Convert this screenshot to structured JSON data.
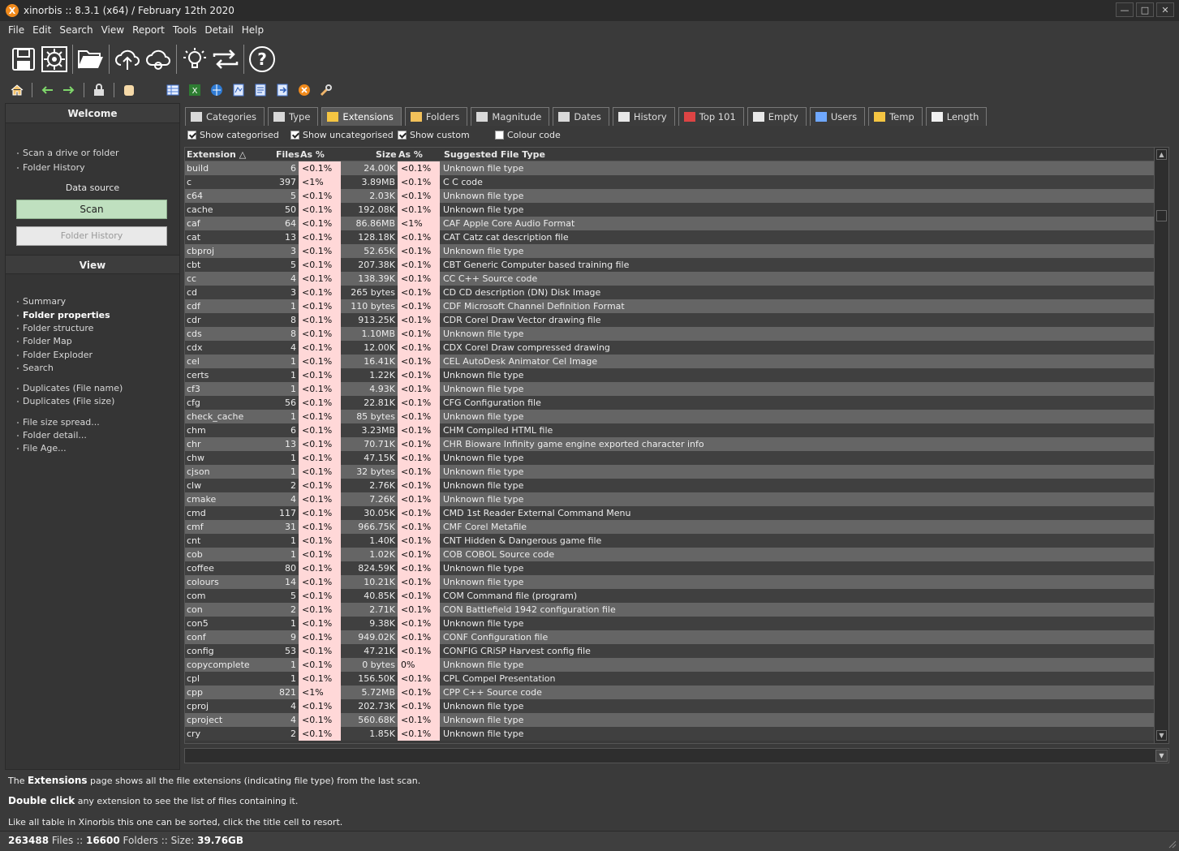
{
  "window": {
    "title": "xinorbis :: 8.3.1 (x64) / February 12th 2020",
    "logo_letter": "X"
  },
  "menu": [
    "File",
    "Edit",
    "Search",
    "View",
    "Report",
    "Tools",
    "Detail",
    "Help"
  ],
  "toolbar_big_icons": [
    "save-icon",
    "scan-settings-icon",
    "open-folder-icon",
    "cloud-upload-icon",
    "cloud-settings-icon",
    "idea-bulb-icon",
    "swap-arrows-icon",
    "help-icon"
  ],
  "toolbar_small_icons": [
    "home-icon",
    "back-arrow-icon",
    "forward-arrow-icon",
    "lock-icon",
    "database-icon",
    "table-icon",
    "excel-icon",
    "web-icon",
    "csv-icon",
    "doc-icon",
    "export-icon",
    "xinorbis-icon",
    "tools-icon"
  ],
  "sidebar": {
    "welcome_title": "Welcome",
    "welcome_links": [
      "Scan a drive or folder",
      "Folder History"
    ],
    "data_source_label": "Data source",
    "scan_button": "Scan",
    "folder_history_button": "Folder History",
    "view_title": "View",
    "view_links": [
      {
        "label": "Summary",
        "bold": false
      },
      {
        "label": "Folder properties",
        "bold": true
      },
      {
        "label": "Folder structure",
        "bold": false
      },
      {
        "label": "Folder Map",
        "bold": false
      },
      {
        "label": "Folder Exploder",
        "bold": false
      },
      {
        "label": "Search",
        "bold": false
      },
      {
        "label": "Duplicates (File name)",
        "bold": false
      },
      {
        "label": "Duplicates (File size)",
        "bold": false
      },
      {
        "label": "File size spread...",
        "bold": false
      },
      {
        "label": "Folder detail...",
        "bold": false
      },
      {
        "label": "File Age...",
        "bold": false
      }
    ]
  },
  "tabs": [
    {
      "label": "Categories",
      "icon": "categories-icon",
      "active": false
    },
    {
      "label": "Type",
      "icon": "type-icon",
      "active": false
    },
    {
      "label": "Extensions",
      "icon": "extensions-icon",
      "active": true
    },
    {
      "label": "Folders",
      "icon": "folder-icon",
      "active": false
    },
    {
      "label": "Magnitude",
      "icon": "magnitude-icon",
      "active": false
    },
    {
      "label": "Dates",
      "icon": "calendar-icon",
      "active": false
    },
    {
      "label": "History",
      "icon": "clock-icon",
      "active": false
    },
    {
      "label": "Top 101",
      "icon": "top-icon",
      "active": false
    },
    {
      "label": "Empty",
      "icon": "empty-file-icon",
      "active": false
    },
    {
      "label": "Users",
      "icon": "users-icon",
      "active": false
    },
    {
      "label": "Temp",
      "icon": "temp-icon",
      "active": false
    },
    {
      "label": "Length",
      "icon": "length-icon",
      "active": false
    }
  ],
  "options": [
    {
      "label": "Show categorised",
      "checked": true
    },
    {
      "label": "Show uncategorised",
      "checked": true
    },
    {
      "label": "Show custom",
      "checked": true
    },
    {
      "label": "Colour code",
      "checked": false
    }
  ],
  "columns": {
    "extension": "Extension",
    "sort_indicator": "△",
    "files": "Files",
    "files_pct": "As %",
    "size": "Size",
    "size_pct": "As %",
    "type": "Suggested File Type"
  },
  "rows": [
    [
      "build",
      "6",
      "<0.1%",
      "24.00K",
      "<0.1%",
      "Unknown file type"
    ],
    [
      "c",
      "397",
      "<1%",
      "3.89MB",
      "<0.1%",
      "C C code"
    ],
    [
      "c64",
      "5",
      "<0.1%",
      "2.03K",
      "<0.1%",
      "Unknown file type"
    ],
    [
      "cache",
      "50",
      "<0.1%",
      "192.08K",
      "<0.1%",
      "Unknown file type"
    ],
    [
      "caf",
      "64",
      "<0.1%",
      "86.86MB",
      "<1%",
      "CAF Apple Core Audio Format"
    ],
    [
      "cat",
      "13",
      "<0.1%",
      "128.18K",
      "<0.1%",
      "CAT Catz cat description file"
    ],
    [
      "cbproj",
      "3",
      "<0.1%",
      "52.65K",
      "<0.1%",
      "Unknown file type"
    ],
    [
      "cbt",
      "5",
      "<0.1%",
      "207.38K",
      "<0.1%",
      "CBT Generic Computer based training file"
    ],
    [
      "cc",
      "4",
      "<0.1%",
      "138.39K",
      "<0.1%",
      "CC C++ Source code"
    ],
    [
      "cd",
      "3",
      "<0.1%",
      "265 bytes",
      "<0.1%",
      "CD CD description (DN) Disk Image"
    ],
    [
      "cdf",
      "1",
      "<0.1%",
      "110 bytes",
      "<0.1%",
      "CDF Microsoft Channel Definition Format"
    ],
    [
      "cdr",
      "8",
      "<0.1%",
      "913.25K",
      "<0.1%",
      "CDR Corel Draw Vector drawing file"
    ],
    [
      "cds",
      "8",
      "<0.1%",
      "1.10MB",
      "<0.1%",
      "Unknown file type"
    ],
    [
      "cdx",
      "4",
      "<0.1%",
      "12.00K",
      "<0.1%",
      "CDX Corel Draw compressed drawing"
    ],
    [
      "cel",
      "1",
      "<0.1%",
      "16.41K",
      "<0.1%",
      "CEL AutoDesk Animator Cel Image"
    ],
    [
      "certs",
      "1",
      "<0.1%",
      "1.22K",
      "<0.1%",
      "Unknown file type"
    ],
    [
      "cf3",
      "1",
      "<0.1%",
      "4.93K",
      "<0.1%",
      "Unknown file type"
    ],
    [
      "cfg",
      "56",
      "<0.1%",
      "22.81K",
      "<0.1%",
      "CFG Configuration file"
    ],
    [
      "check_cache",
      "1",
      "<0.1%",
      "85 bytes",
      "<0.1%",
      "Unknown file type"
    ],
    [
      "chm",
      "6",
      "<0.1%",
      "3.23MB",
      "<0.1%",
      "CHM Compiled HTML file"
    ],
    [
      "chr",
      "13",
      "<0.1%",
      "70.71K",
      "<0.1%",
      "CHR Bioware Infinity game engine exported character info"
    ],
    [
      "chw",
      "1",
      "<0.1%",
      "47.15K",
      "<0.1%",
      "Unknown file type"
    ],
    [
      "cjson",
      "1",
      "<0.1%",
      "32 bytes",
      "<0.1%",
      "Unknown file type"
    ],
    [
      "clw",
      "2",
      "<0.1%",
      "2.76K",
      "<0.1%",
      "Unknown file type"
    ],
    [
      "cmake",
      "4",
      "<0.1%",
      "7.26K",
      "<0.1%",
      "Unknown file type"
    ],
    [
      "cmd",
      "117",
      "<0.1%",
      "30.05K",
      "<0.1%",
      "CMD 1st Reader External Command Menu"
    ],
    [
      "cmf",
      "31",
      "<0.1%",
      "966.75K",
      "<0.1%",
      "CMF Corel Metafile"
    ],
    [
      "cnt",
      "1",
      "<0.1%",
      "1.40K",
      "<0.1%",
      "CNT Hidden & Dangerous game file"
    ],
    [
      "cob",
      "1",
      "<0.1%",
      "1.02K",
      "<0.1%",
      "COB COBOL Source code"
    ],
    [
      "coffee",
      "80",
      "<0.1%",
      "824.59K",
      "<0.1%",
      "Unknown file type"
    ],
    [
      "colours",
      "14",
      "<0.1%",
      "10.21K",
      "<0.1%",
      "Unknown file type"
    ],
    [
      "com",
      "5",
      "<0.1%",
      "40.85K",
      "<0.1%",
      "COM Command file (program)"
    ],
    [
      "con",
      "2",
      "<0.1%",
      "2.71K",
      "<0.1%",
      "CON Battlefield 1942 configuration file"
    ],
    [
      "con5",
      "1",
      "<0.1%",
      "9.38K",
      "<0.1%",
      "Unknown file type"
    ],
    [
      "conf",
      "9",
      "<0.1%",
      "949.02K",
      "<0.1%",
      "CONF Configuration file"
    ],
    [
      "config",
      "53",
      "<0.1%",
      "47.21K",
      "<0.1%",
      "CONFIG CRiSP Harvest config file"
    ],
    [
      "copycomplete",
      "1",
      "<0.1%",
      "0 bytes",
      "0%",
      "Unknown file type"
    ],
    [
      "cpl",
      "1",
      "<0.1%",
      "156.50K",
      "<0.1%",
      "CPL Compel Presentation"
    ],
    [
      "cpp",
      "821",
      "<1%",
      "5.72MB",
      "<0.1%",
      "CPP C++ Source code"
    ],
    [
      "cproj",
      "4",
      "<0.1%",
      "202.73K",
      "<0.1%",
      "Unknown file type"
    ],
    [
      "cproject",
      "4",
      "<0.1%",
      "560.68K",
      "<0.1%",
      "Unknown file type"
    ],
    [
      "cry",
      "2",
      "<0.1%",
      "1.85K",
      "<0.1%",
      "Unknown file type"
    ]
  ],
  "info": {
    "line1_pre": "The ",
    "line1_bold": "Extensions",
    "line1_post": " page shows all the file extensions (indicating file type) from the last scan.",
    "line2_bold": "Double  click",
    "line2_post": "  any extension to see the list of files containing it.",
    "line3": "Like all table in Xinorbis this one can be sorted, click the title cell to resort."
  },
  "status": {
    "files": "263488",
    "files_label": " Files  ::  ",
    "folders": "16600",
    "folders_label": " Folders  ::  Size: ",
    "size": "39.76GB"
  }
}
